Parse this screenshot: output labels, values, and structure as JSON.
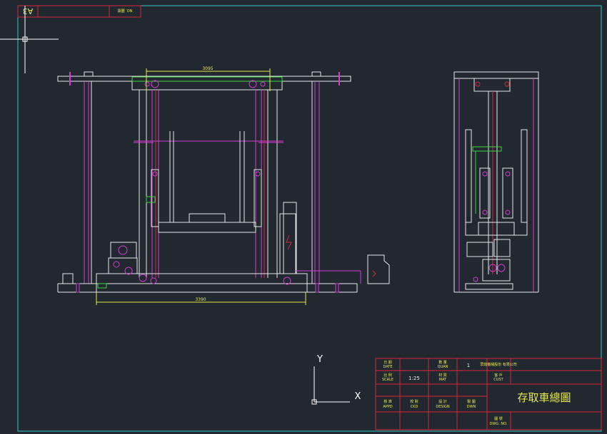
{
  "sheet": {
    "size_label": "A3",
    "corner_note": "NO.\n圖號"
  },
  "dimensions": {
    "top_width": "3095",
    "bottom_length": "3390"
  },
  "ucs": {
    "x_label": "X",
    "y_label": "Y"
  },
  "title_block": {
    "date_label": "日 期",
    "date_en": "DATE",
    "quan_label": "數 量",
    "quan_en": "QUAN",
    "quan_value": "1",
    "company_label": "眾鼎機械股份\n有限公司",
    "scale_label": "比 例",
    "scale_en": "SCALE",
    "scale_value": "1:25",
    "mat_label": "材 質",
    "mat_en": "MAT",
    "cust_label": "客 戶",
    "cust_en": "CUST",
    "title": "存取車總圖",
    "appd_label": "核 准",
    "appd_en": "APPD",
    "ckd_label": "校 對",
    "ckd_en": "CKD",
    "design_label": "設 計",
    "design_en": "DESIGN",
    "dwn_label": "製 圖",
    "dwn_en": "DWN",
    "dwg_label": "圖 號",
    "dwg_en": "DWG. NO."
  },
  "colors": {
    "background": "#212830",
    "border": "#33c7c7",
    "lines": "#e8e8e8",
    "magenta": "#d23ad2",
    "red": "#d9263a",
    "yellow": "#e8e84a",
    "green": "#3fd23f",
    "title_border": "#d9263a"
  }
}
